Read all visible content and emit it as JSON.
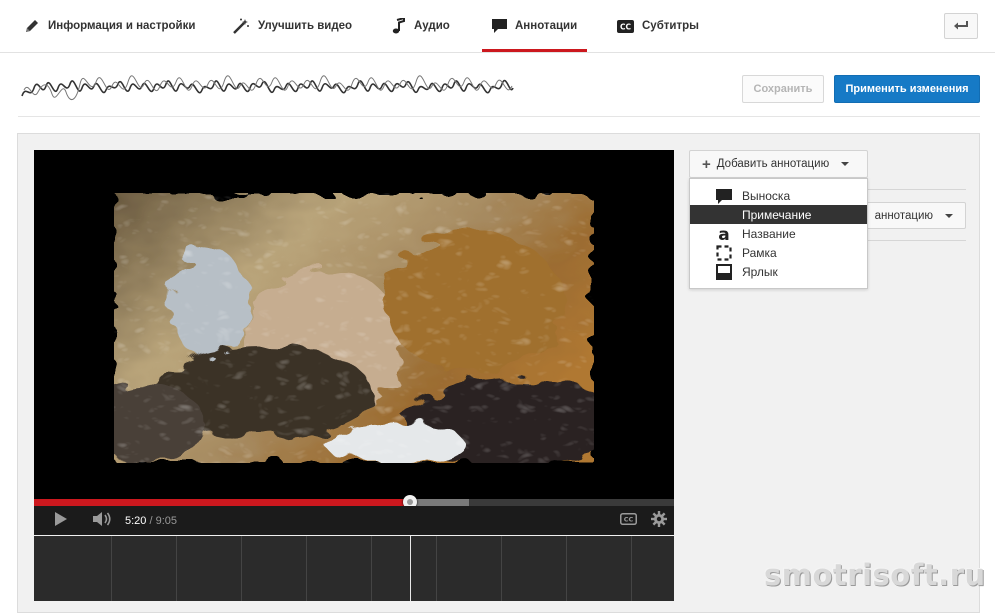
{
  "tabs": [
    {
      "label": "Информация и настройки",
      "icon": "pencil-icon",
      "active": false
    },
    {
      "label": "Улучшить видео",
      "icon": "magic-wand-icon",
      "active": false
    },
    {
      "label": "Аудио",
      "icon": "music-note-icon",
      "active": false
    },
    {
      "label": "Аннотации",
      "icon": "speech-bubble-icon",
      "active": true
    },
    {
      "label": "Субтитры",
      "icon": "cc-icon",
      "active": false
    }
  ],
  "back_icon": "back-arrow-icon",
  "toolbar": {
    "save_label": "Сохранить",
    "apply_label": "Применить изменения"
  },
  "player": {
    "current_time": "5:20",
    "duration": "9:05",
    "progress_fraction": 0.587,
    "buffered_fraction": 0.68,
    "icons": [
      "play-icon",
      "volume-icon",
      "cc-icon",
      "settings-gear-icon"
    ]
  },
  "annotations": {
    "add_label": "Добавить аннотацию",
    "add_label_partial": "аннотацию",
    "menu": [
      {
        "label": "Выноска",
        "icon": "speech-bubble-icon",
        "selected": false
      },
      {
        "label": "Примечание",
        "icon": "",
        "selected": true
      },
      {
        "label": "Название",
        "icon": "title-letter-icon",
        "selected": false
      },
      {
        "label": "Рамка",
        "icon": "dashed-frame-icon",
        "selected": false
      },
      {
        "label": "Ярлык",
        "icon": "label-icon",
        "selected": false
      }
    ]
  },
  "watermark": "smotrisoft.ru",
  "colors": {
    "accent_red": "#cc181e",
    "primary_blue": "#167ac6",
    "selected_menu": "#333333"
  }
}
